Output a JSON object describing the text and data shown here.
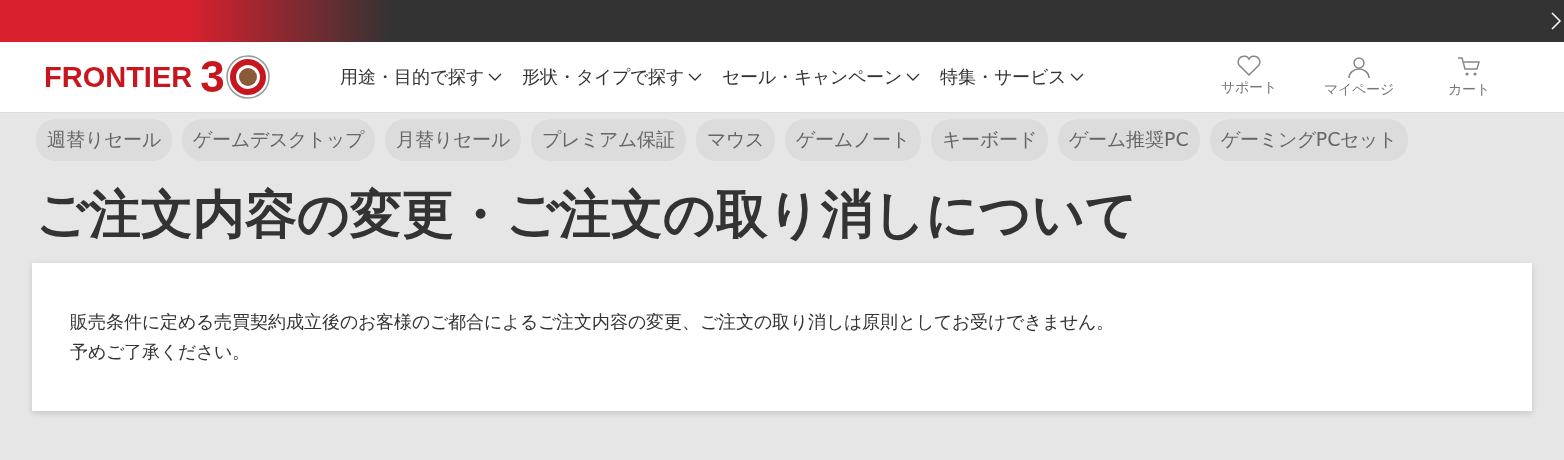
{
  "logo": {
    "text": "FRONTIER",
    "number": "3"
  },
  "nav": [
    {
      "label": "用途・目的で探す"
    },
    {
      "label": "形状・タイプで探す"
    },
    {
      "label": "セール・キャンペーン"
    },
    {
      "label": "特集・サービス"
    }
  ],
  "header_links": [
    {
      "label": "サポート",
      "kind": "heart"
    },
    {
      "label": "マイページ",
      "kind": "person"
    },
    {
      "label": "カート",
      "kind": "cart"
    }
  ],
  "tags": [
    "週替りセール",
    "ゲームデスクトップ",
    "月替りセール",
    "プレミアム保証",
    "マウス",
    "ゲームノート",
    "キーボード",
    "ゲーム推奨PC",
    "ゲーミングPCセット"
  ],
  "title": "ご注文内容の変更・ご注文の取り消しについて",
  "notice": [
    "販売条件に定める売買契約成立後のお客様のご都合によるご注文内容の変更、ご注文の取り消しは原則としてお受けできません。",
    "予めご了承ください。"
  ]
}
